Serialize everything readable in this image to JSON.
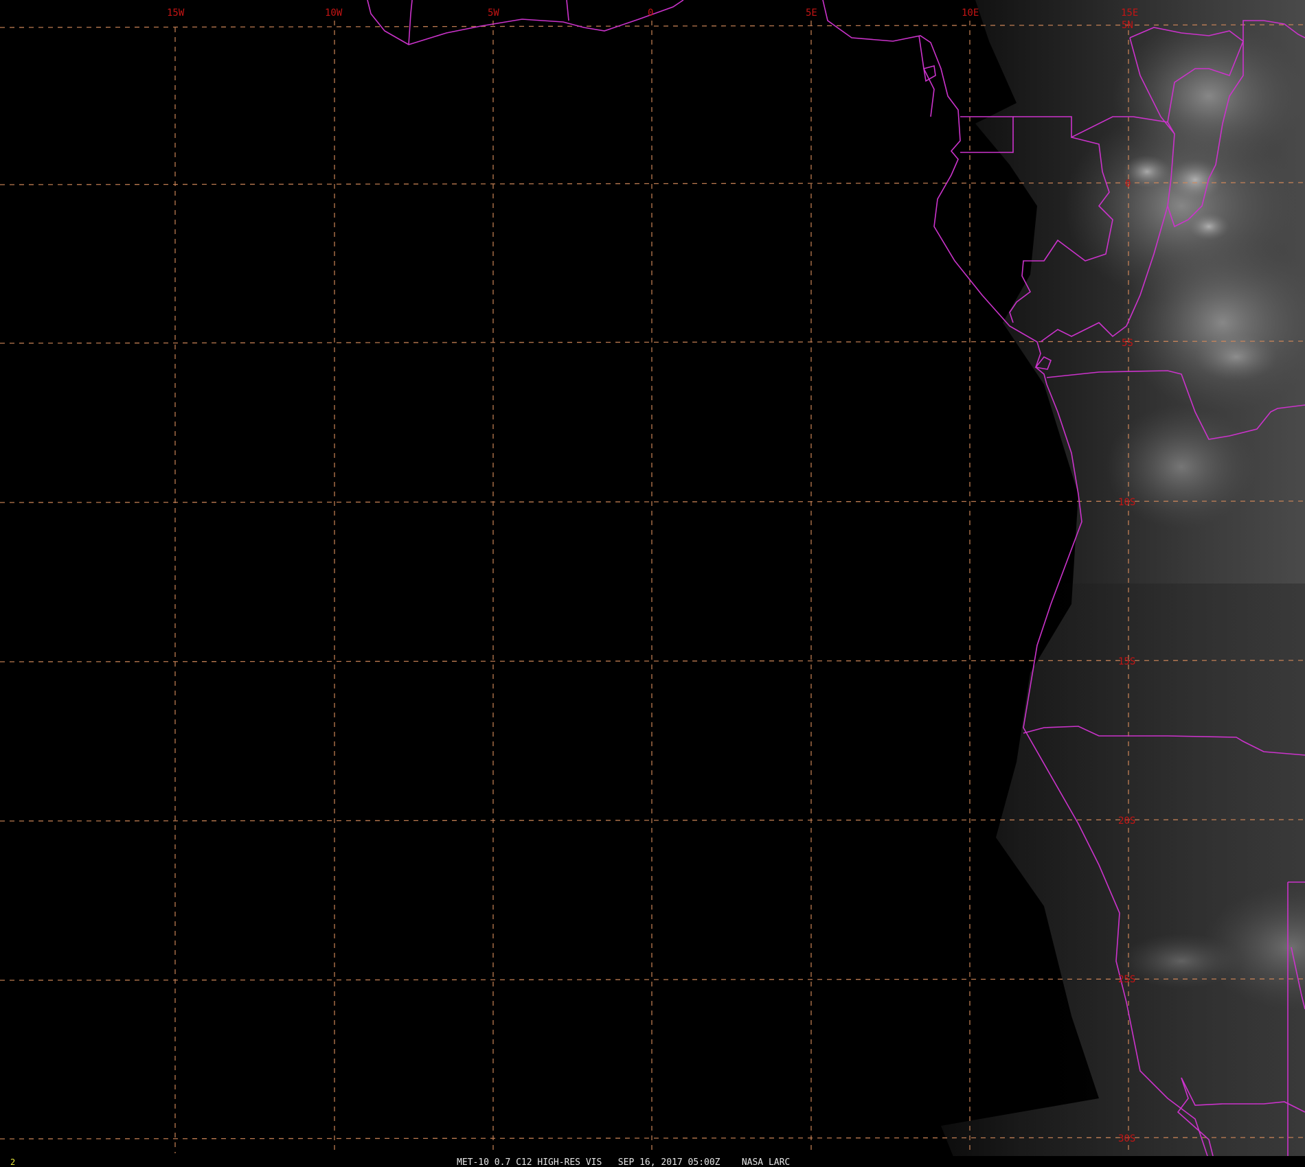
{
  "footer": {
    "frame_number": "2",
    "caption": "MET-10 0.7 C12 HIGH-RES VIS   SEP 16, 2017 05:00Z    NASA LARC"
  },
  "grid": {
    "longitude_labels": [
      "15W",
      "10W",
      "5W",
      "0",
      "5E",
      "10E",
      "15E"
    ],
    "latitude_labels": [
      "5N",
      "0",
      "5S",
      "10S",
      "15S",
      "20S",
      "25S",
      "30S"
    ]
  },
  "colors": {
    "background": "#000000",
    "grid_line": "#d2885a",
    "grid_label": "#c41414",
    "boundaries": "#cc33cc",
    "footer_text": "#e6e6e6",
    "frame_number": "#e5e53a"
  }
}
